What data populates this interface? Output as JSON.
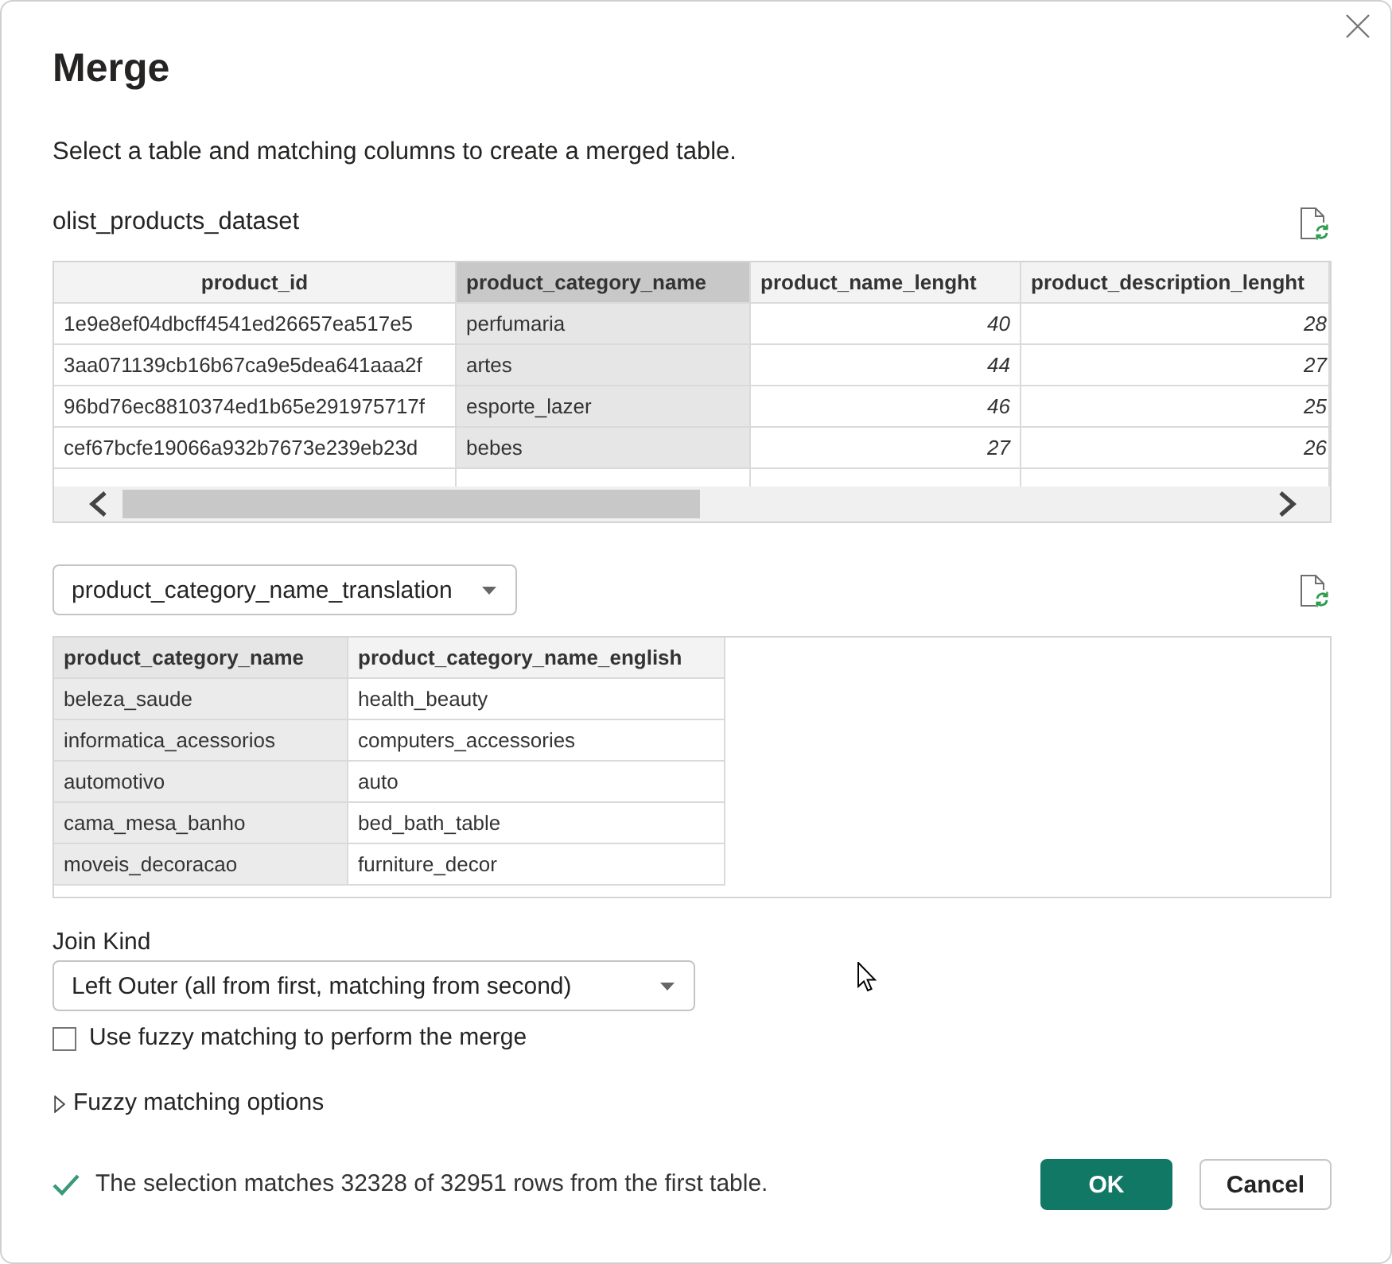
{
  "dialog": {
    "title": "Merge",
    "description": "Select a table and matching columns to create a merged table."
  },
  "first_table": {
    "name": "olist_products_dataset",
    "focused": true,
    "columns": [
      {
        "label": "product_id",
        "kind": "id",
        "selected": false
      },
      {
        "label": "product_category_name",
        "kind": "text",
        "selected": true
      },
      {
        "label": "product_name_lenght",
        "kind": "number",
        "selected": false
      },
      {
        "label": "product_description_lenght",
        "kind": "number",
        "selected": false
      }
    ],
    "rows": [
      [
        "1e9e8ef04dbcff4541ed26657ea517e5",
        "perfumaria",
        "40",
        "28"
      ],
      [
        "3aa071139cb16b67ca9e5dea641aaa2f",
        "artes",
        "44",
        "27"
      ],
      [
        "96bd76ec8810374ed1b65e291975717f",
        "esporte_lazer",
        "46",
        "25"
      ],
      [
        "cef67bcfe19066a932b7673e239eb23d",
        "bebes",
        "27",
        "26"
      ]
    ]
  },
  "second_table": {
    "selector": {
      "value": "product_category_name_translation"
    },
    "focused": false,
    "columns": [
      {
        "label": "product_category_name",
        "selected": true
      },
      {
        "label": "product_category_name_english",
        "selected": false
      }
    ],
    "rows": [
      [
        "beleza_saude",
        "health_beauty"
      ],
      [
        "informatica_acessorios",
        "computers_accessories"
      ],
      [
        "automotivo",
        "auto"
      ],
      [
        "cama_mesa_banho",
        "bed_bath_table"
      ],
      [
        "moveis_decoracao",
        "furniture_decor"
      ]
    ]
  },
  "join_kind": {
    "label": "Join Kind",
    "value": "Left Outer (all from first, matching from second)"
  },
  "fuzzy_matching": {
    "label": "Use fuzzy matching to perform the merge",
    "checked": false
  },
  "fuzzy_options": {
    "label": "Fuzzy matching options",
    "expanded": false
  },
  "status": {
    "kind": "success",
    "text": "The selection matches 32328 of 32951 rows from the first table."
  },
  "buttons": [
    {
      "label": "OK",
      "kind": "primary"
    },
    {
      "label": "Cancel",
      "kind": "secondary"
    }
  ]
}
